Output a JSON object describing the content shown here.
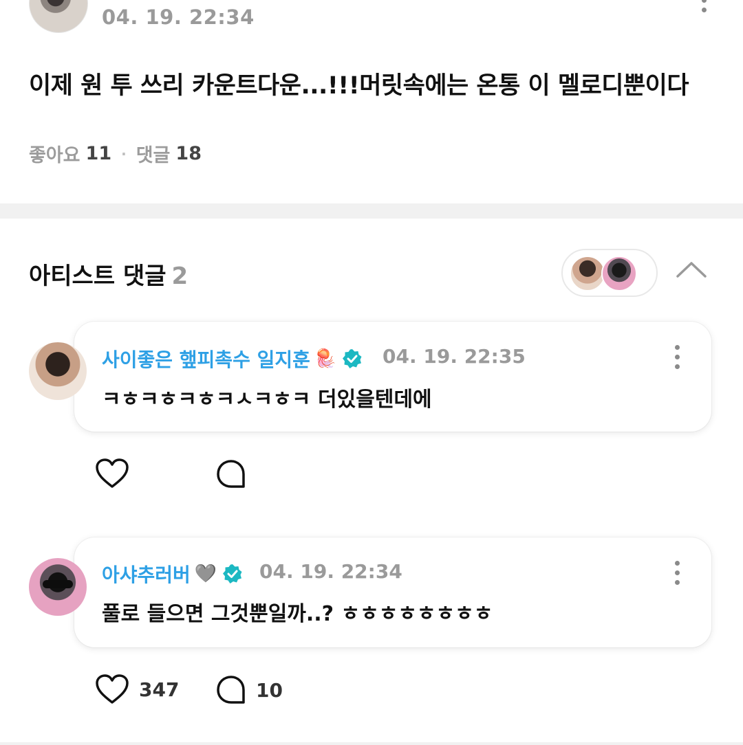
{
  "post": {
    "time": "04. 19. 22:34",
    "body": "이제 원 투 쓰리 카운트다운...!!!머릿속에는 온통 이 멜로디뿐이다",
    "likes_label": "좋아요",
    "likes": "11",
    "comments_label": "댓글",
    "comments": "18"
  },
  "artist_section": {
    "title": "아티스트 댓글",
    "count": "2"
  },
  "comments": [
    {
      "name": "사이좋은 햎피촉수 일지훈",
      "emoji": "🪼",
      "time": "04. 19. 22:35",
      "text": "ㅋㅎㅋㅎㅋㅎㅋㅅㅋㅎㅋ 더있을텐데에",
      "likes": "",
      "replies": ""
    },
    {
      "name": "아샤추러버",
      "emoji": "🩶",
      "time": "04. 19. 22:34",
      "text": "풀로 들으면 그것뿐일까..? ㅎㅎㅎㅎㅎㅎㅎㅎ",
      "likes": "347",
      "replies": "10"
    }
  ],
  "colors": {
    "username": "#2ea0e5",
    "verified": "#1cb8c2",
    "muted": "#9a9a9a"
  },
  "icons": [
    "kebab-menu-icon",
    "chevron-up-icon",
    "heart-icon",
    "reply-bubble-icon",
    "verified-badge-icon"
  ]
}
